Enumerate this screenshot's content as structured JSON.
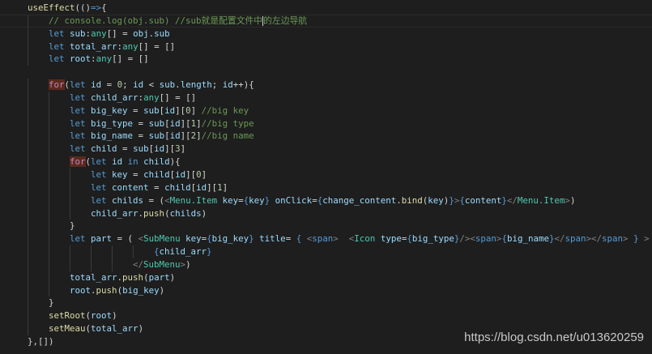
{
  "colors": {
    "background": "#1e1e1e",
    "keyword": "#569cd6",
    "variable": "#9cdcfe",
    "type": "#4ec9b0",
    "comment": "#6a9955",
    "function": "#dcdcaa"
  },
  "lines": [
    {
      "indent": 4,
      "tokens": [
        [
          "f",
          "useEffect"
        ],
        [
          "p",
          "(()"
        ],
        [
          "k",
          "=>"
        ],
        [
          "p",
          "{"
        ]
      ]
    },
    {
      "indent": 8,
      "current": true,
      "tokens": [
        [
          "c",
          "// console.log(obj.sub) //sub就是配置文件中"
        ],
        [
          "cursor",
          ""
        ],
        [
          "c",
          "的左边导航"
        ]
      ]
    },
    {
      "indent": 8,
      "tokens": [
        [
          "k",
          "let "
        ],
        [
          "v",
          "sub"
        ],
        [
          "p",
          ":"
        ],
        [
          "t",
          "any"
        ],
        [
          "p",
          "[] = "
        ],
        [
          "v",
          "obj"
        ],
        [
          "p",
          "."
        ],
        [
          "v",
          "sub"
        ]
      ]
    },
    {
      "indent": 8,
      "tokens": [
        [
          "k",
          "let "
        ],
        [
          "v",
          "total_arr"
        ],
        [
          "p",
          ":"
        ],
        [
          "t",
          "any"
        ],
        [
          "p",
          "[] = []"
        ]
      ]
    },
    {
      "indent": 8,
      "tokens": [
        [
          "k",
          "let "
        ],
        [
          "v",
          "root"
        ],
        [
          "p",
          ":"
        ],
        [
          "t",
          "any"
        ],
        [
          "p",
          "[] = []"
        ]
      ]
    },
    {
      "indent": 0,
      "tokens": []
    },
    {
      "indent": 8,
      "tokens": [
        [
          "ctl",
          "for"
        ],
        [
          "p",
          "("
        ],
        [
          "k",
          "let "
        ],
        [
          "v",
          "id"
        ],
        [
          "p",
          " = "
        ],
        [
          "n",
          "0"
        ],
        [
          "p",
          "; "
        ],
        [
          "v",
          "id"
        ],
        [
          "p",
          " < "
        ],
        [
          "v",
          "sub"
        ],
        [
          "p",
          "."
        ],
        [
          "v",
          "length"
        ],
        [
          "p",
          "; "
        ],
        [
          "v",
          "id"
        ],
        [
          "p",
          "++){"
        ]
      ]
    },
    {
      "indent": 12,
      "tokens": [
        [
          "k",
          "let "
        ],
        [
          "v",
          "child_arr"
        ],
        [
          "p",
          ":"
        ],
        [
          "t",
          "any"
        ],
        [
          "p",
          "[] = []"
        ]
      ]
    },
    {
      "indent": 12,
      "tokens": [
        [
          "k",
          "let "
        ],
        [
          "v",
          "big_key"
        ],
        [
          "p",
          " = "
        ],
        [
          "v",
          "sub"
        ],
        [
          "p",
          "["
        ],
        [
          "v",
          "id"
        ],
        [
          "p",
          "]["
        ],
        [
          "n",
          "0"
        ],
        [
          "p",
          "] "
        ],
        [
          "c",
          "//big key"
        ]
      ]
    },
    {
      "indent": 12,
      "tokens": [
        [
          "k",
          "let "
        ],
        [
          "v",
          "big_type"
        ],
        [
          "p",
          " = "
        ],
        [
          "v",
          "sub"
        ],
        [
          "p",
          "["
        ],
        [
          "v",
          "id"
        ],
        [
          "p",
          "]["
        ],
        [
          "n",
          "1"
        ],
        [
          "p",
          "]"
        ],
        [
          "c",
          "//big type"
        ]
      ]
    },
    {
      "indent": 12,
      "tokens": [
        [
          "k",
          "let "
        ],
        [
          "v",
          "big_name"
        ],
        [
          "p",
          " = "
        ],
        [
          "v",
          "sub"
        ],
        [
          "p",
          "["
        ],
        [
          "v",
          "id"
        ],
        [
          "p",
          "]["
        ],
        [
          "n",
          "2"
        ],
        [
          "p",
          "]"
        ],
        [
          "c",
          "//big name"
        ]
      ]
    },
    {
      "indent": 12,
      "tokens": [
        [
          "k",
          "let "
        ],
        [
          "v",
          "child"
        ],
        [
          "p",
          " = "
        ],
        [
          "v",
          "sub"
        ],
        [
          "p",
          "["
        ],
        [
          "v",
          "id"
        ],
        [
          "p",
          "]["
        ],
        [
          "n",
          "3"
        ],
        [
          "p",
          "]"
        ]
      ]
    },
    {
      "indent": 12,
      "tokens": [
        [
          "ctl",
          "for"
        ],
        [
          "p",
          "("
        ],
        [
          "k",
          "let "
        ],
        [
          "v",
          "id"
        ],
        [
          "k",
          " in "
        ],
        [
          "v",
          "child"
        ],
        [
          "p",
          "){"
        ]
      ]
    },
    {
      "indent": 16,
      "tokens": [
        [
          "k",
          "let "
        ],
        [
          "v",
          "key"
        ],
        [
          "p",
          " = "
        ],
        [
          "v",
          "child"
        ],
        [
          "p",
          "["
        ],
        [
          "v",
          "id"
        ],
        [
          "p",
          "]["
        ],
        [
          "n",
          "0"
        ],
        [
          "p",
          "]"
        ]
      ]
    },
    {
      "indent": 16,
      "tokens": [
        [
          "k",
          "let "
        ],
        [
          "v",
          "content"
        ],
        [
          "p",
          " = "
        ],
        [
          "v",
          "child"
        ],
        [
          "p",
          "["
        ],
        [
          "v",
          "id"
        ],
        [
          "p",
          "]["
        ],
        [
          "n",
          "1"
        ],
        [
          "p",
          "]"
        ]
      ]
    },
    {
      "indent": 16,
      "tokens": [
        [
          "k",
          "let "
        ],
        [
          "v",
          "childs"
        ],
        [
          "p",
          " = ("
        ],
        [
          "ang",
          "<"
        ],
        [
          "tg",
          "Menu.Item"
        ],
        [
          "v",
          " key"
        ],
        [
          "p",
          "="
        ],
        [
          "k",
          "{"
        ],
        [
          "v",
          "key"
        ],
        [
          "k",
          "}"
        ],
        [
          "v",
          " onClick"
        ],
        [
          "p",
          "="
        ],
        [
          "k",
          "{"
        ],
        [
          "v",
          "change_content"
        ],
        [
          "p",
          "."
        ],
        [
          "f",
          "bind"
        ],
        [
          "p",
          "("
        ],
        [
          "v",
          "key"
        ],
        [
          "p",
          ")"
        ],
        [
          "k",
          "}"
        ],
        [
          "ang",
          ">"
        ],
        [
          "k",
          "{"
        ],
        [
          "v",
          "content"
        ],
        [
          "k",
          "}"
        ],
        [
          "ang",
          "</"
        ],
        [
          "tg",
          "Menu.Item"
        ],
        [
          "ang",
          ">"
        ],
        [
          "p",
          ")"
        ]
      ]
    },
    {
      "indent": 16,
      "tokens": [
        [
          "v",
          "child_arr"
        ],
        [
          "p",
          "."
        ],
        [
          "f",
          "push"
        ],
        [
          "p",
          "("
        ],
        [
          "v",
          "childs"
        ],
        [
          "p",
          ")"
        ]
      ]
    },
    {
      "indent": 12,
      "tokens": [
        [
          "p",
          "}"
        ]
      ]
    },
    {
      "indent": 12,
      "tokens": [
        [
          "k",
          "let "
        ],
        [
          "v",
          "part"
        ],
        [
          "p",
          " = ( "
        ],
        [
          "ang",
          "<"
        ],
        [
          "tg",
          "SubMenu"
        ],
        [
          "v",
          " key"
        ],
        [
          "p",
          "="
        ],
        [
          "k",
          "{"
        ],
        [
          "v",
          "big_key"
        ],
        [
          "k",
          "}"
        ],
        [
          "v",
          " title"
        ],
        [
          "p",
          "= "
        ],
        [
          "k",
          "{ "
        ],
        [
          "ang",
          "<"
        ],
        [
          "k",
          "span"
        ],
        [
          "ang",
          ">"
        ],
        [
          "p",
          "  "
        ],
        [
          "ang",
          "<"
        ],
        [
          "tg",
          "Icon"
        ],
        [
          "v",
          " type"
        ],
        [
          "p",
          "="
        ],
        [
          "k",
          "{"
        ],
        [
          "v",
          "big_type"
        ],
        [
          "k",
          "}"
        ],
        [
          "ang",
          "/><"
        ],
        [
          "k",
          "span"
        ],
        [
          "ang",
          ">"
        ],
        [
          "k",
          "{"
        ],
        [
          "v",
          "big_name"
        ],
        [
          "k",
          "}"
        ],
        [
          "ang",
          "</"
        ],
        [
          "k",
          "span"
        ],
        [
          "ang",
          "></"
        ],
        [
          "k",
          "span"
        ],
        [
          "ang",
          ">"
        ],
        [
          "k",
          " } "
        ],
        [
          "ang",
          ">"
        ]
      ]
    },
    {
      "indent": 28,
      "tokens": [
        [
          "k",
          "{"
        ],
        [
          "v",
          "child_arr"
        ],
        [
          "k",
          "}"
        ]
      ]
    },
    {
      "indent": 24,
      "tokens": [
        [
          "ang",
          "</"
        ],
        [
          "tg",
          "SubMenu"
        ],
        [
          "ang",
          ">"
        ],
        [
          "p",
          ")"
        ]
      ]
    },
    {
      "indent": 12,
      "tokens": [
        [
          "v",
          "total_arr"
        ],
        [
          "p",
          "."
        ],
        [
          "f",
          "push"
        ],
        [
          "p",
          "("
        ],
        [
          "v",
          "part"
        ],
        [
          "p",
          ")"
        ]
      ]
    },
    {
      "indent": 12,
      "tokens": [
        [
          "v",
          "root"
        ],
        [
          "p",
          "."
        ],
        [
          "f",
          "push"
        ],
        [
          "p",
          "("
        ],
        [
          "v",
          "big_key"
        ],
        [
          "p",
          ")"
        ]
      ]
    },
    {
      "indent": 8,
      "tokens": [
        [
          "p",
          "}"
        ]
      ]
    },
    {
      "indent": 8,
      "tokens": [
        [
          "f",
          "setRoot"
        ],
        [
          "p",
          "("
        ],
        [
          "v",
          "root"
        ],
        [
          "p",
          ")"
        ]
      ]
    },
    {
      "indent": 8,
      "tokens": [
        [
          "f",
          "setMeau"
        ],
        [
          "p",
          "("
        ],
        [
          "v",
          "total_arr"
        ],
        [
          "p",
          ")"
        ]
      ]
    },
    {
      "indent": 4,
      "tokens": [
        [
          "p",
          "},[])"
        ]
      ]
    }
  ],
  "watermark": "https://blog.csdn.net/u013620259"
}
